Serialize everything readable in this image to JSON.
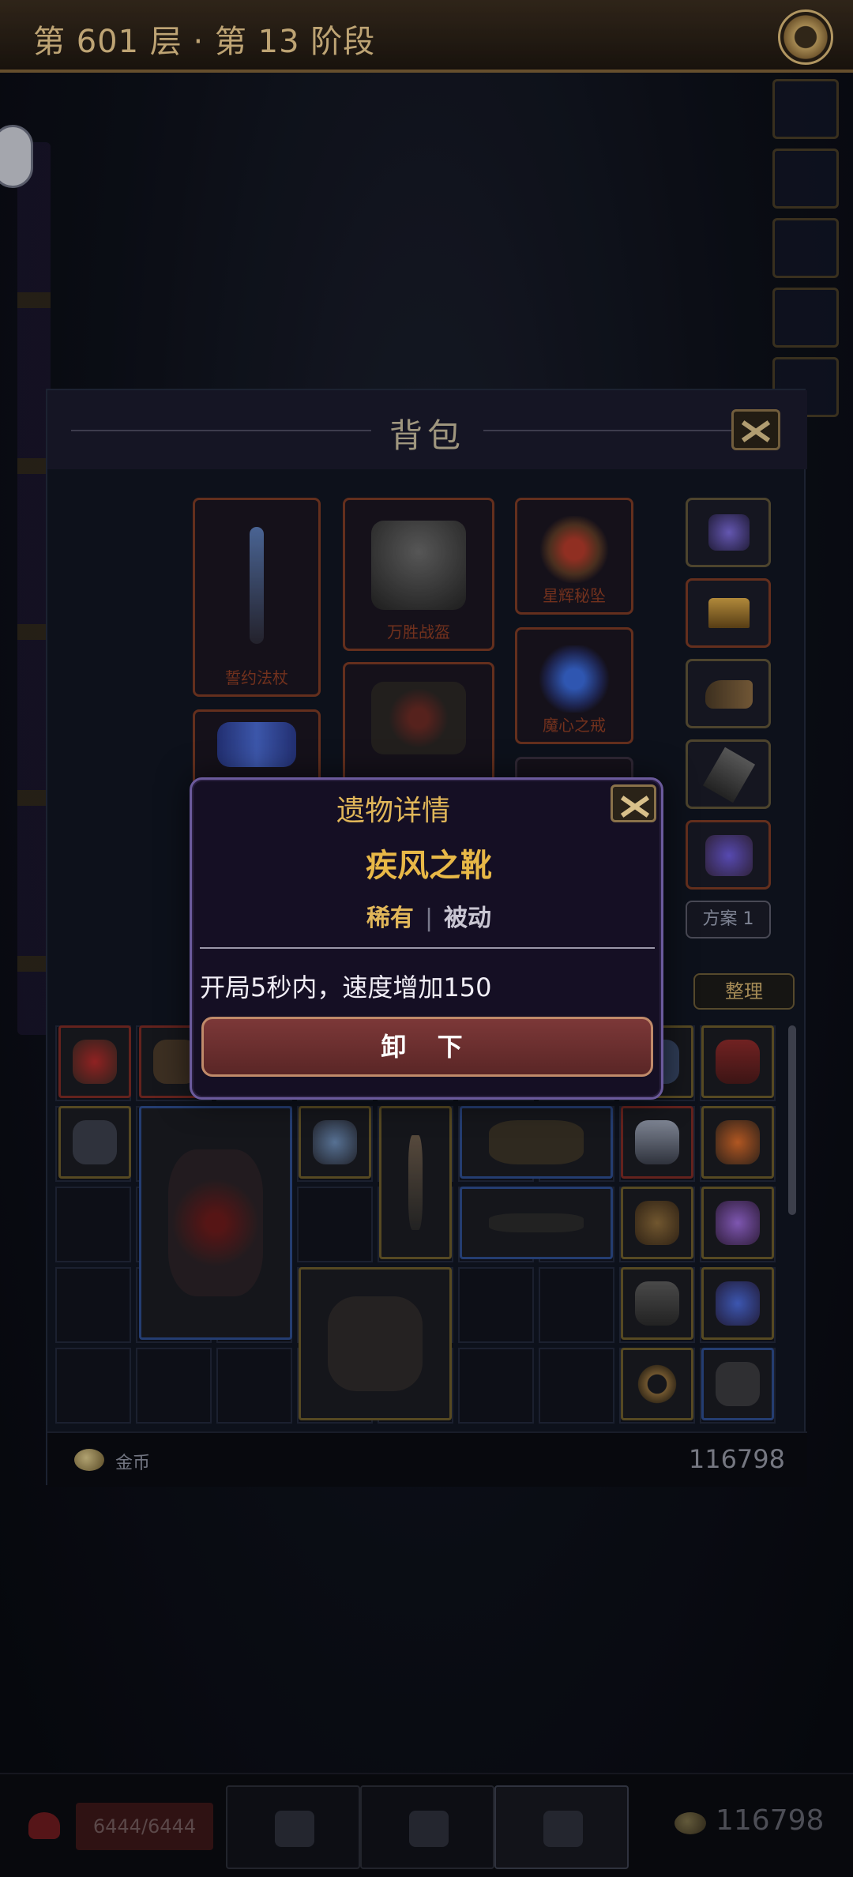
{
  "header": {
    "stage_title": "第 601 层 · 第 13 阶段"
  },
  "bag": {
    "title": "背包",
    "equipped": [
      {
        "name": "誓约法杖",
        "icon": "staff-icon"
      },
      {
        "name": "万胜战盔",
        "icon": "helmet-icon"
      },
      {
        "name": "星辉秘坠",
        "icon": "amulet-icon"
      },
      {
        "name": "魔心之戒",
        "icon": "ring-icon"
      },
      {
        "name": "",
        "icon": "gauntlet-icon"
      },
      {
        "name": "",
        "icon": "armor-icon"
      }
    ],
    "scheme_label": "方案 1",
    "sort_label": "整理",
    "currency_label": "金币",
    "currency_value": "116798"
  },
  "bottom_bar": {
    "hp": "6444/6444",
    "gold": "116798"
  },
  "relic_dialog": {
    "title": "遗物详情",
    "name": "疾风之靴",
    "rarity": "稀有",
    "separator": "|",
    "type": "被动",
    "description": "开局5秒内，速度增加150",
    "unequip_label": "卸 下"
  },
  "colors": {
    "accent_gold": "#e8b847",
    "dialog_bg": "#150f24",
    "button_red": "#7c3838"
  }
}
